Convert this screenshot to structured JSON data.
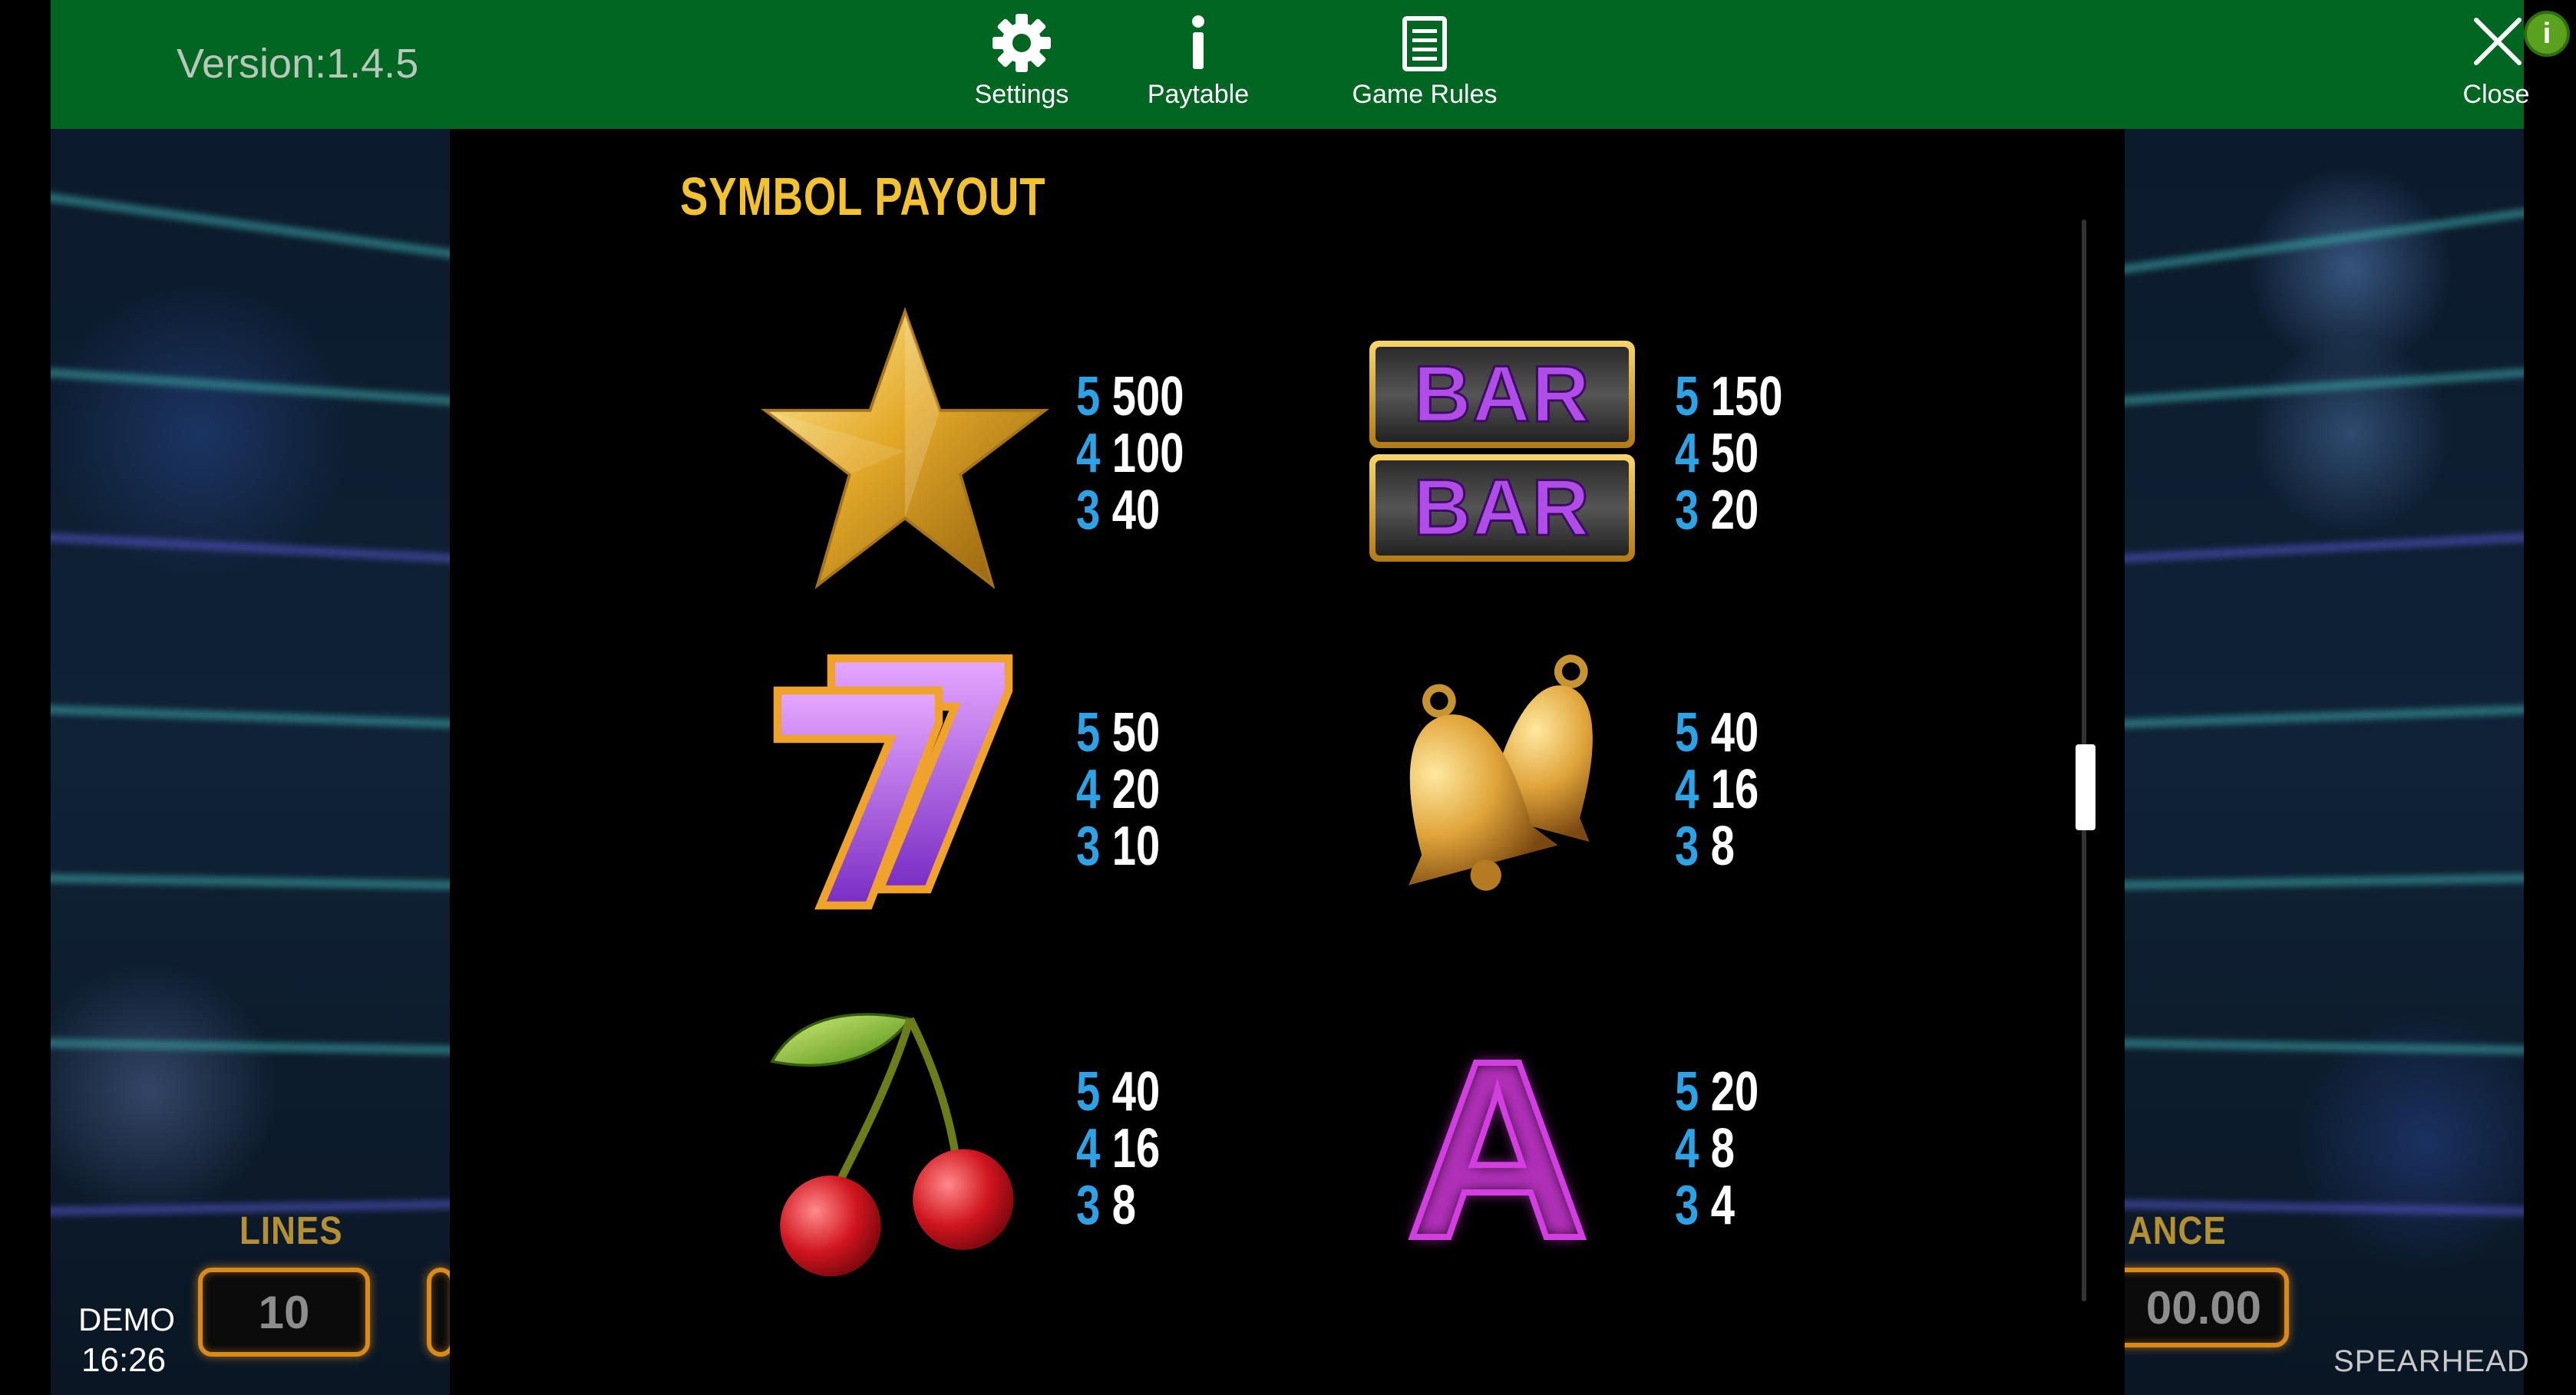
{
  "header": {
    "version": "Version:1.4.5",
    "nav": [
      {
        "label": "Settings",
        "icon": "gear-icon"
      },
      {
        "label": "Paytable",
        "icon": "info-icon"
      },
      {
        "label": "Game Rules",
        "icon": "document-icon"
      }
    ],
    "close_label": "Close",
    "info_badge": "i"
  },
  "paytable": {
    "title": "SYMBOL PAYOUT",
    "symbols": [
      {
        "name": "star",
        "payouts": [
          {
            "count": "5",
            "value": "500"
          },
          {
            "count": "4",
            "value": "100"
          },
          {
            "count": "3",
            "value": "40"
          }
        ]
      },
      {
        "name": "double-bar",
        "label": "BAR",
        "payouts": [
          {
            "count": "5",
            "value": "150"
          },
          {
            "count": "4",
            "value": "50"
          },
          {
            "count": "3",
            "value": "20"
          }
        ]
      },
      {
        "name": "seven",
        "payouts": [
          {
            "count": "5",
            "value": "50"
          },
          {
            "count": "4",
            "value": "20"
          },
          {
            "count": "3",
            "value": "10"
          }
        ]
      },
      {
        "name": "bell",
        "payouts": [
          {
            "count": "5",
            "value": "40"
          },
          {
            "count": "4",
            "value": "16"
          },
          {
            "count": "3",
            "value": "8"
          }
        ]
      },
      {
        "name": "cherry",
        "payouts": [
          {
            "count": "5",
            "value": "40"
          },
          {
            "count": "4",
            "value": "16"
          },
          {
            "count": "3",
            "value": "8"
          }
        ]
      },
      {
        "name": "letter-a",
        "label": "A",
        "payouts": [
          {
            "count": "5",
            "value": "20"
          },
          {
            "count": "4",
            "value": "8"
          },
          {
            "count": "3",
            "value": "4"
          }
        ]
      }
    ]
  },
  "game": {
    "lines_label": "LINES",
    "lines_value": "10",
    "balance_label_partial": "ANCE",
    "balance_value_partial": "00.00",
    "mode": "DEMO",
    "time": "16:26",
    "brand": "SPEARHEAD"
  },
  "colors": {
    "header_green": "#006622",
    "title_gold": "#f2c231",
    "count_blue": "#2ca3e6",
    "box_orange": "#d98a1a"
  }
}
